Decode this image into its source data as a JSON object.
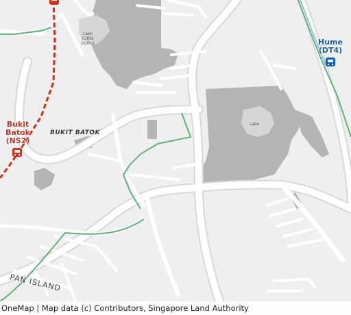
{
  "map": {
    "stations": {
      "bukit_batok": {
        "name": "Bukit\nBatok",
        "code": "(NS2)",
        "line_color": "#d42e12"
      },
      "hume": {
        "name": "Hume",
        "code": "(DT4)",
        "line_color": "#005ec4"
      }
    },
    "areas": {
      "bukit_batok": "BUKIT BATOK"
    },
    "lakes": {
      "little_guilin": "Lake\n(Little\nGuilin)",
      "lake": "Lake"
    },
    "roads": {
      "pan_island": "PAN ISLAND"
    },
    "colors": {
      "background": "#efefef",
      "road": "#ffffff",
      "road_casing": "#d8d8d8",
      "building": "#b0b0b0",
      "path": "#5fb37a",
      "rail": "#d42e12"
    },
    "attribution": "OneMap | Map data (c) Contributors, Singapore Land Authority"
  }
}
